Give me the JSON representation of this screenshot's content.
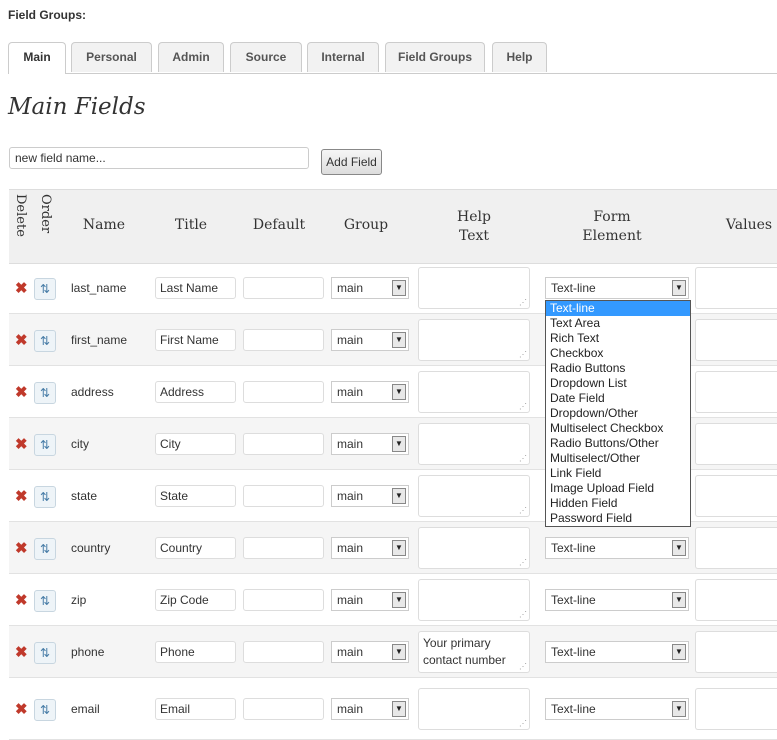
{
  "field_groups_label": "Field Groups:",
  "tabs": [
    {
      "label": "Main"
    },
    {
      "label": "Personal"
    },
    {
      "label": "Admin"
    },
    {
      "label": "Source"
    },
    {
      "label": "Internal"
    },
    {
      "label": "Field Groups"
    },
    {
      "label": "Help"
    }
  ],
  "section_title": "Main Fields",
  "new_field": {
    "placeholder": "new field name..."
  },
  "add_field_label": "Add Field",
  "headers": {
    "delete": "Delete",
    "order": "Order",
    "name": "Name",
    "title": "Title",
    "default": "Default",
    "group": "Group",
    "help_text_1": "Help",
    "help_text_2": "Text",
    "form_element_1": "Form",
    "form_element_2": "Element",
    "values": "Values"
  },
  "icons": {
    "delete": "✖",
    "order": "⇅",
    "grip": "⋰"
  },
  "rows": [
    {
      "name": "last_name",
      "title": "Last Name",
      "default": "",
      "group": "main",
      "help_1": "",
      "help_2": "",
      "form_element": "Text-line"
    },
    {
      "name": "first_name",
      "title": "First Name",
      "default": "",
      "group": "main",
      "help_1": "",
      "help_2": "",
      "form_element": ""
    },
    {
      "name": "address",
      "title": "Address",
      "default": "",
      "group": "main",
      "help_1": "",
      "help_2": "",
      "form_element": ""
    },
    {
      "name": "city",
      "title": "City",
      "default": "",
      "group": "main",
      "help_1": "",
      "help_2": "",
      "form_element": ""
    },
    {
      "name": "state",
      "title": "State",
      "default": "",
      "group": "main",
      "help_1": "",
      "help_2": "",
      "form_element": ""
    },
    {
      "name": "country",
      "title": "Country",
      "default": "",
      "group": "main",
      "help_1": "",
      "help_2": "",
      "form_element": "Text-line"
    },
    {
      "name": "zip",
      "title": "Zip Code",
      "default": "",
      "group": "main",
      "help_1": "",
      "help_2": "",
      "form_element": "Text-line"
    },
    {
      "name": "phone",
      "title": "Phone",
      "default": "",
      "group": "main",
      "help_1": "Your primary",
      "help_2": "contact number",
      "form_element": "Text-line"
    },
    {
      "name": "email",
      "title": "Email",
      "default": "",
      "group": "main",
      "help_1": "",
      "help_2": "",
      "form_element": "Text-line"
    }
  ],
  "dropdown_options": [
    "Text-line",
    "Text Area",
    "Rich Text",
    "Checkbox",
    "Radio Buttons",
    "Dropdown List",
    "Date Field",
    "Dropdown/Other",
    "Multiselect Checkbox",
    "Radio Buttons/Other",
    "Multiselect/Other",
    "Link Field",
    "Image Upload Field",
    "Hidden Field",
    "Password Field"
  ],
  "dropdown_selected_index": 0
}
